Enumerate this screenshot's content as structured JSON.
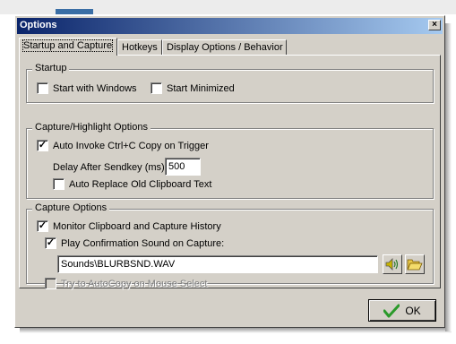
{
  "window": {
    "title": "Options",
    "close_glyph": "×"
  },
  "tabs": [
    {
      "label": "Startup and Capture",
      "active": true
    },
    {
      "label": "Hotkeys",
      "active": false
    },
    {
      "label": "Display Options / Behavior",
      "active": false
    }
  ],
  "startup": {
    "legend": "Startup",
    "start_with_windows": {
      "label": "Start with Windows",
      "checked": false
    },
    "start_minimized": {
      "label": "Start Minimized",
      "checked": false
    }
  },
  "capture_highlight": {
    "legend": "Capture/Highlight Options",
    "auto_invoke": {
      "label": "Auto Invoke Ctrl+C Copy on Trigger",
      "checked": true
    },
    "delay_label": "Delay After Sendkey (ms):",
    "delay_value": "500",
    "auto_replace": {
      "label": "Auto Replace Old Clipboard Text",
      "checked": false
    }
  },
  "capture_options": {
    "legend": "Capture Options",
    "monitor_clipboard": {
      "label": "Monitor Clipboard and Capture History",
      "checked": true
    },
    "play_sound": {
      "label": "Play Confirmation Sound on Capture:",
      "checked": true
    },
    "sound_path": "Sounds\\BLURBSND.WAV",
    "try_autocopy": {
      "label": "Try to AutoCopy on Mouse Select",
      "checked": false,
      "disabled": true
    }
  },
  "buttons": {
    "ok_label": "OK",
    "play_icon": "speaker-icon",
    "browse_icon": "folder-open-icon"
  },
  "colors": {
    "titlebar_start": "#0a246a",
    "titlebar_end": "#a6caf0",
    "face": "#d4d0c8",
    "ok_check": "#2a9a2a"
  }
}
